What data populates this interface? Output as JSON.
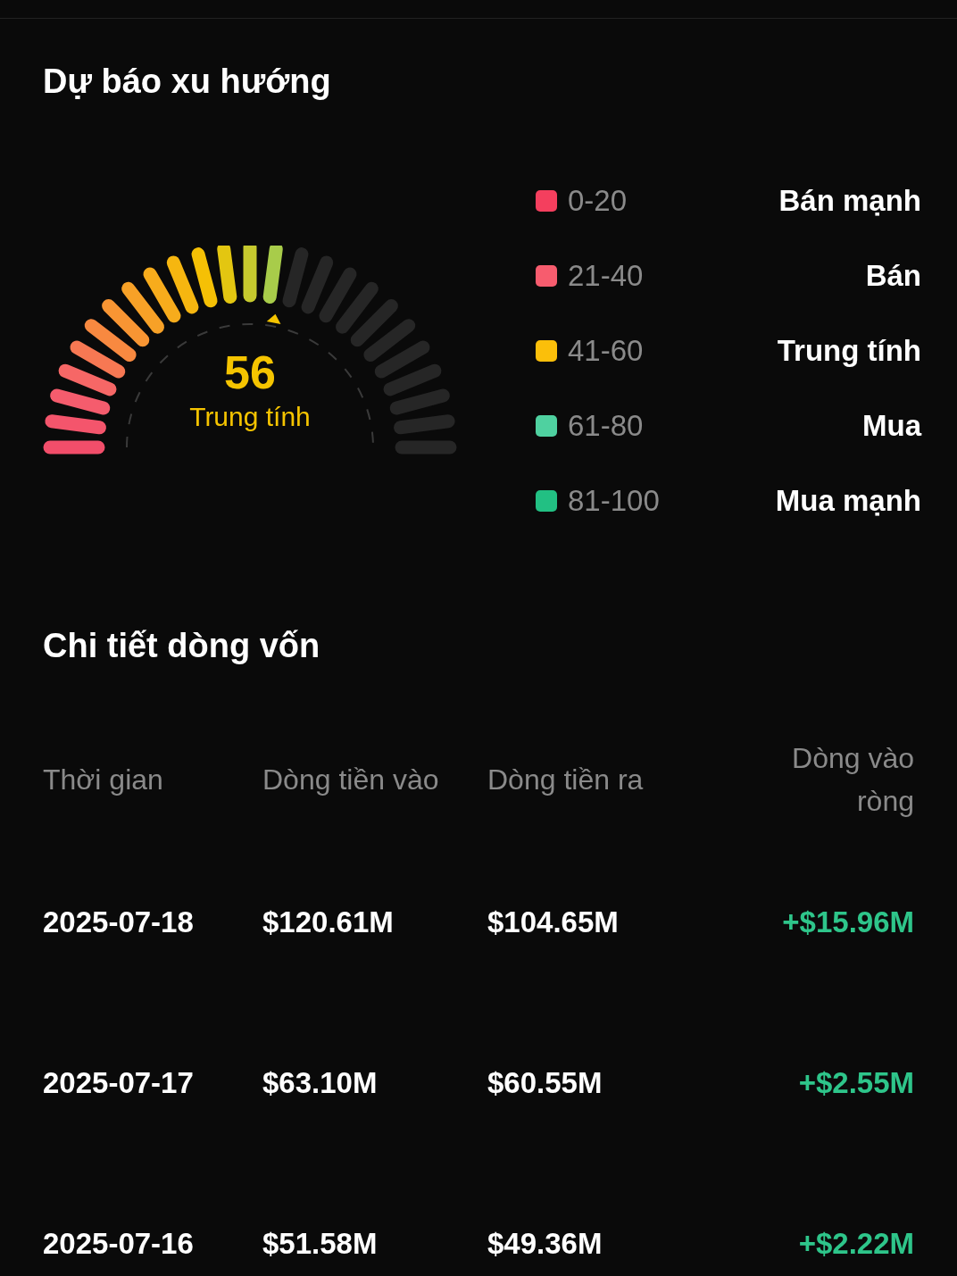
{
  "forecast": {
    "title": "Dự báo xu hướng",
    "gauge": {
      "value": "56",
      "label": "Trung tính",
      "level": 0.56
    },
    "legend": [
      {
        "range": "0-20",
        "label": "Bán mạnh",
        "color": "#f43f5e"
      },
      {
        "range": "21-40",
        "label": "Bán",
        "color": "#f75c6e"
      },
      {
        "range": "41-60",
        "label": "Trung tính",
        "color": "#fbbf0a"
      },
      {
        "range": "61-80",
        "label": "Mua",
        "color": "#4fd1a0"
      },
      {
        "range": "81-100",
        "label": "Mua mạnh",
        "color": "#22c083"
      }
    ]
  },
  "flow": {
    "title": "Chi tiết dòng vốn",
    "columns": [
      "Thời gian",
      "Dòng tiền vào",
      "Dòng tiền ra",
      "Dòng vào ròng"
    ],
    "rows": [
      {
        "date": "2025-07-18",
        "inflow": "$120.61M",
        "outflow": "$104.65M",
        "net": "+$15.96M"
      },
      {
        "date": "2025-07-17",
        "inflow": "$63.10M",
        "outflow": "$60.55M",
        "net": "+$2.55M"
      },
      {
        "date": "2025-07-16",
        "inflow": "$51.58M",
        "outflow": "$49.36M",
        "net": "+$2.22M"
      }
    ]
  }
}
